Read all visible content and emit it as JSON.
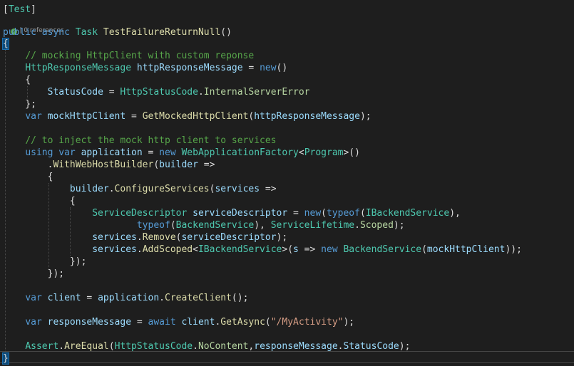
{
  "editor": {
    "language": "C#",
    "theme_colors": {
      "background": "#1e1e1e",
      "keyword": "#569cd6",
      "control_keyword": "#d8a0df",
      "type": "#4ec9b0",
      "method": "#dcdcaa",
      "identifier": "#9cdcfe",
      "string": "#d69d85",
      "comment": "#57a64a",
      "enum_member": "#b8d7a3"
    },
    "codelens": {
      "status_icon": "check-circle-icon",
      "text": "| 0 references"
    },
    "lines": [
      {
        "t": [
          [
            "pu",
            "["
          ],
          [
            "ty",
            "Test"
          ],
          [
            "pu",
            "]"
          ]
        ]
      },
      {
        "t": [
          [
            "kw",
            "public"
          ],
          [
            "pu",
            " "
          ],
          [
            "kw",
            "async"
          ],
          [
            "pu",
            " "
          ],
          [
            "ty",
            "Task"
          ],
          [
            "pu",
            " "
          ],
          [
            "fn",
            "TestFailureReturnNull"
          ],
          [
            "pu",
            "()"
          ]
        ]
      },
      {
        "t": [
          [
            "pu",
            "{"
          ]
        ]
      },
      {
        "t": [
          [
            "pu",
            "    "
          ],
          [
            "com",
            "// mocking HttpClient with custom reponse"
          ]
        ]
      },
      {
        "t": [
          [
            "pu",
            "    "
          ],
          [
            "ty",
            "HttpResponseMessage"
          ],
          [
            "pu",
            " "
          ],
          [
            "var",
            "httpResponseMessage"
          ],
          [
            "pu",
            " = "
          ],
          [
            "kw",
            "new"
          ],
          [
            "pu",
            "()"
          ]
        ]
      },
      {
        "t": [
          [
            "pu",
            "    {"
          ]
        ]
      },
      {
        "t": [
          [
            "pu",
            "        "
          ],
          [
            "var",
            "StatusCode"
          ],
          [
            "pu",
            " = "
          ],
          [
            "ty",
            "HttpStatusCode"
          ],
          [
            "pu",
            "."
          ],
          [
            "en",
            "InternalServerError"
          ]
        ]
      },
      {
        "t": [
          [
            "pu",
            "    };"
          ]
        ]
      },
      {
        "t": [
          [
            "pu",
            "    "
          ],
          [
            "kw",
            "var"
          ],
          [
            "pu",
            " "
          ],
          [
            "var",
            "mockHttpClient"
          ],
          [
            "pu",
            " = "
          ],
          [
            "fn",
            "GetMockedHttpClient"
          ],
          [
            "pu",
            "("
          ],
          [
            "var",
            "httpResponseMessage"
          ],
          [
            "pu",
            ");"
          ]
        ]
      },
      {
        "t": []
      },
      {
        "t": [
          [
            "pu",
            "    "
          ],
          [
            "com",
            "// to inject the mock http client to services"
          ]
        ]
      },
      {
        "t": [
          [
            "pu",
            "    "
          ],
          [
            "kw",
            "using"
          ],
          [
            "pu",
            " "
          ],
          [
            "kw",
            "var"
          ],
          [
            "pu",
            " "
          ],
          [
            "var",
            "application"
          ],
          [
            "pu",
            " = "
          ],
          [
            "kw",
            "new"
          ],
          [
            "pu",
            " "
          ],
          [
            "ty",
            "WebApplicationFactory"
          ],
          [
            "pu",
            "<"
          ],
          [
            "ty",
            "Program"
          ],
          [
            "pu",
            ">()"
          ]
        ]
      },
      {
        "t": [
          [
            "pu",
            "        ."
          ],
          [
            "fn",
            "WithWebHostBuilder"
          ],
          [
            "pu",
            "("
          ],
          [
            "var",
            "builder"
          ],
          [
            "pu",
            " =>"
          ]
        ]
      },
      {
        "t": [
          [
            "pu",
            "        {"
          ]
        ]
      },
      {
        "t": [
          [
            "pu",
            "            "
          ],
          [
            "var",
            "builder"
          ],
          [
            "pu",
            "."
          ],
          [
            "fn",
            "ConfigureServices"
          ],
          [
            "pu",
            "("
          ],
          [
            "var",
            "services"
          ],
          [
            "pu",
            " =>"
          ]
        ]
      },
      {
        "t": [
          [
            "pu",
            "            {"
          ]
        ]
      },
      {
        "t": [
          [
            "pu",
            "                "
          ],
          [
            "ty",
            "ServiceDescriptor"
          ],
          [
            "pu",
            " "
          ],
          [
            "var",
            "serviceDescriptor"
          ],
          [
            "pu",
            " = "
          ],
          [
            "kw",
            "new"
          ],
          [
            "pu",
            "("
          ],
          [
            "kw",
            "typeof"
          ],
          [
            "pu",
            "("
          ],
          [
            "ty",
            "IBackendService"
          ],
          [
            "pu",
            "),"
          ]
        ]
      },
      {
        "t": [
          [
            "pu",
            "                        "
          ],
          [
            "kw",
            "typeof"
          ],
          [
            "pu",
            "("
          ],
          [
            "ty",
            "BackendService"
          ],
          [
            "pu",
            "), "
          ],
          [
            "ty",
            "ServiceLifetime"
          ],
          [
            "pu",
            "."
          ],
          [
            "en",
            "Scoped"
          ],
          [
            "pu",
            ");"
          ]
        ]
      },
      {
        "t": [
          [
            "pu",
            "                "
          ],
          [
            "var",
            "services"
          ],
          [
            "pu",
            "."
          ],
          [
            "fn",
            "Remove"
          ],
          [
            "pu",
            "("
          ],
          [
            "var",
            "serviceDescriptor"
          ],
          [
            "pu",
            ");"
          ]
        ]
      },
      {
        "t": [
          [
            "pu",
            "                "
          ],
          [
            "var",
            "services"
          ],
          [
            "pu",
            "."
          ],
          [
            "fn",
            "AddScoped"
          ],
          [
            "pu",
            "<"
          ],
          [
            "ty",
            "IBackendService"
          ],
          [
            "pu",
            ">("
          ],
          [
            "var",
            "s"
          ],
          [
            "pu",
            " => "
          ],
          [
            "kw",
            "new"
          ],
          [
            "pu",
            " "
          ],
          [
            "ty",
            "BackendService"
          ],
          [
            "pu",
            "("
          ],
          [
            "var",
            "mockHttpClient"
          ],
          [
            "pu",
            "));"
          ]
        ]
      },
      {
        "t": [
          [
            "pu",
            "            });"
          ]
        ]
      },
      {
        "t": [
          [
            "pu",
            "        });"
          ]
        ]
      },
      {
        "t": []
      },
      {
        "t": [
          [
            "pu",
            "    "
          ],
          [
            "kw",
            "var"
          ],
          [
            "pu",
            " "
          ],
          [
            "var",
            "client"
          ],
          [
            "pu",
            " = "
          ],
          [
            "var",
            "application"
          ],
          [
            "pu",
            "."
          ],
          [
            "fn",
            "CreateClient"
          ],
          [
            "pu",
            "();"
          ]
        ]
      },
      {
        "t": []
      },
      {
        "t": [
          [
            "pu",
            "    "
          ],
          [
            "kw",
            "var"
          ],
          [
            "pu",
            " "
          ],
          [
            "var",
            "responseMessage"
          ],
          [
            "pu",
            " = "
          ],
          [
            "kw",
            "await"
          ],
          [
            "pu",
            " "
          ],
          [
            "var",
            "client"
          ],
          [
            "pu",
            "."
          ],
          [
            "fn",
            "GetAsync"
          ],
          [
            "pu",
            "("
          ],
          [
            "str",
            "\"/MyActivity\""
          ],
          [
            "pu",
            ");"
          ]
        ]
      },
      {
        "t": []
      },
      {
        "t": [
          [
            "pu",
            "    "
          ],
          [
            "ty",
            "Assert"
          ],
          [
            "pu",
            "."
          ],
          [
            "fn",
            "AreEqual"
          ],
          [
            "pu",
            "("
          ],
          [
            "ty",
            "HttpStatusCode"
          ],
          [
            "pu",
            "."
          ],
          [
            "en",
            "NoContent"
          ],
          [
            "pu",
            ","
          ],
          [
            "var",
            "responseMessage"
          ],
          [
            "pu",
            "."
          ],
          [
            "var",
            "StatusCode"
          ],
          [
            "pu",
            ");"
          ]
        ]
      },
      {
        "t": []
      },
      {
        "t": [
          [
            "pu",
            "}"
          ]
        ]
      }
    ]
  }
}
